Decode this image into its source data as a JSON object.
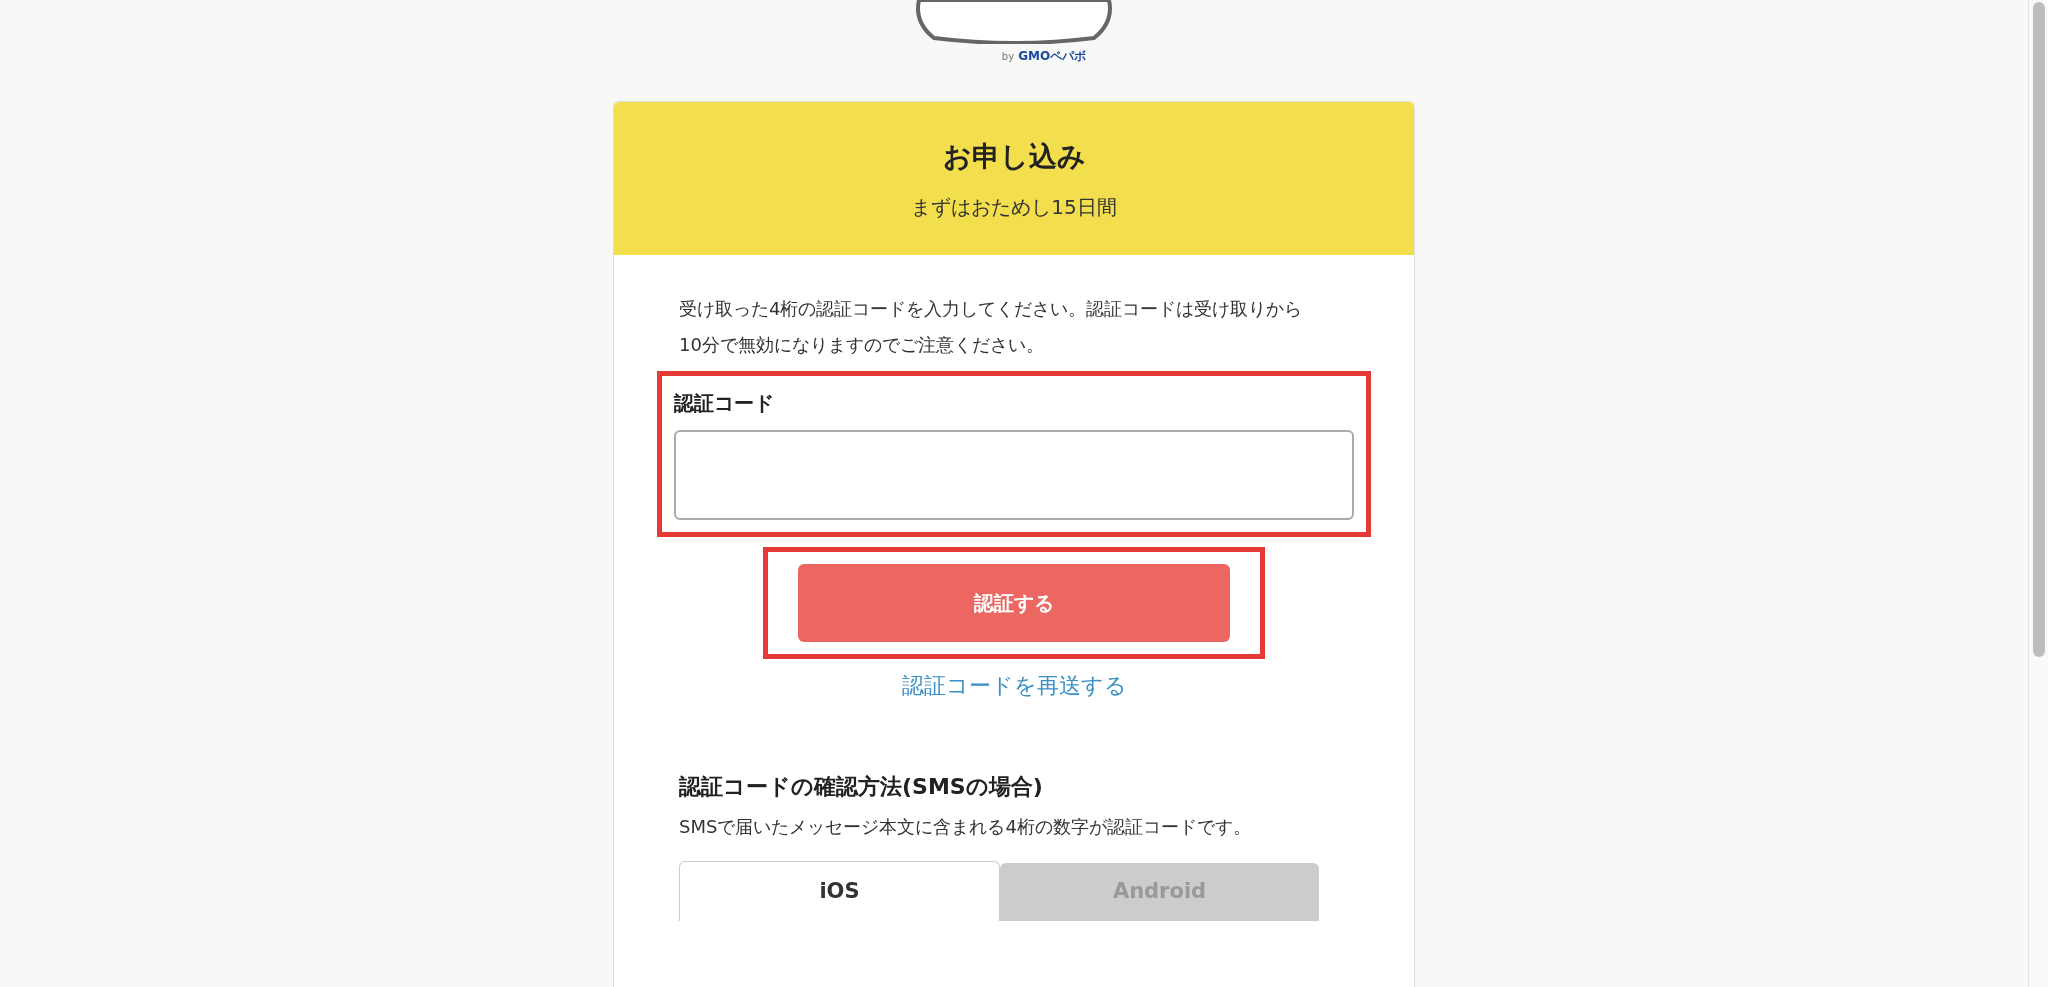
{
  "logo": {
    "byline": "by",
    "brand": "GMOペパボ"
  },
  "header": {
    "title": "お申し込み",
    "subtitle": "まずはおためし15日間"
  },
  "instructions": "受け取った4桁の認証コードを入力してください。認証コードは受け取りから10分で無効になりますのでご注意ください。",
  "code_field": {
    "label": "認証コード",
    "highlighted": true
  },
  "submit_button": {
    "label": "認証する",
    "highlighted": true
  },
  "resend_link": "認証コードを再送する",
  "help": {
    "heading": "認証コードの確認方法(SMSの場合)",
    "text": "SMSで届いたメッセージ本文に含まれる4桁の数字が認証コードです。",
    "tabs": [
      {
        "label": "iOS",
        "selected": true
      },
      {
        "label": "Android",
        "selected": false
      }
    ]
  }
}
